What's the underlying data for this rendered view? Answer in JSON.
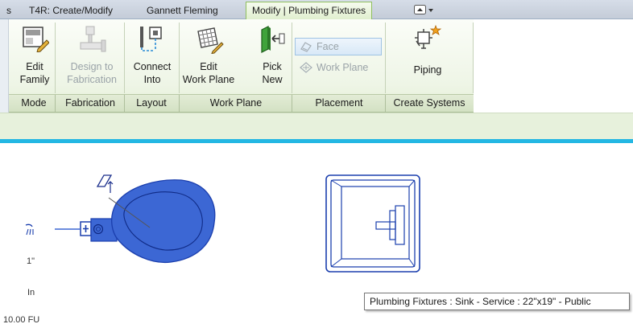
{
  "tabs": {
    "partial": "s",
    "t4r": "T4R: Create/Modify",
    "gannett": "Gannett Fleming",
    "active": "Modify | Plumbing Fixtures"
  },
  "ribbon": {
    "tools": {
      "edit_family": [
        "Edit",
        "Family"
      ],
      "design_fabrication": [
        "Design to",
        "Fabrication"
      ],
      "connect_into": [
        "Connect",
        "Into"
      ],
      "edit_work_plane": [
        "Edit",
        "Work Plane"
      ],
      "pick_new": [
        "Pick",
        "New"
      ],
      "face": "Face",
      "work_plane": "Work Plane",
      "piping": "Piping"
    },
    "panels": {
      "mode": "Mode",
      "fabrication": "Fabrication",
      "layout": "Layout",
      "work_plane": "Work Plane",
      "placement": "Placement",
      "create_systems": "Create Systems"
    }
  },
  "annotations": {
    "pipe_size": "1\"",
    "connector_type": "In",
    "fixture_units": "10.00 FU"
  },
  "tooltip": "Plumbing Fixtures : Sink - Service : 22\"x19\" - Public",
  "colors": {
    "ribbon_tab_active": "#dfeecd",
    "view_border": "#24b7e3",
    "fixture_fill": "#3c67d4",
    "fixture_stroke": "#1b3fae"
  }
}
